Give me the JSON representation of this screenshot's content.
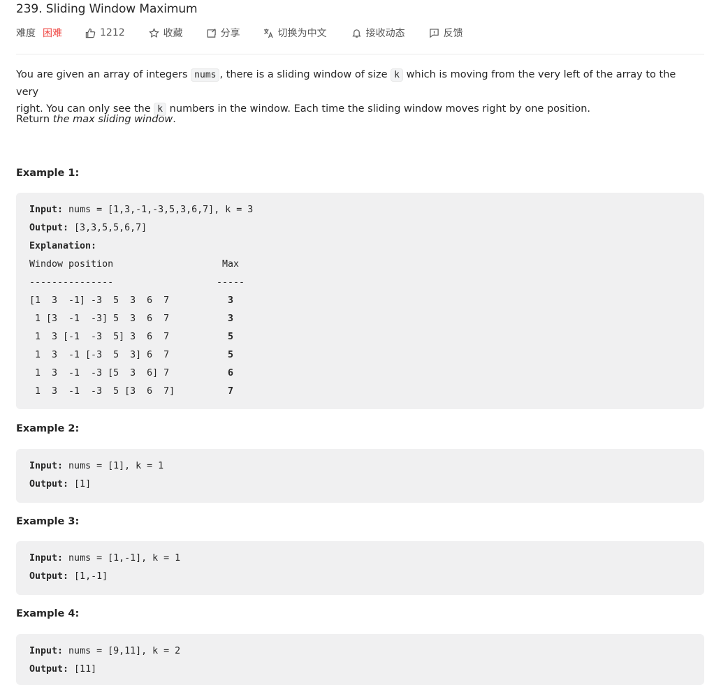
{
  "problem": {
    "title": "239. Sliding Window Maximum"
  },
  "toolbar": {
    "difficulty_label": "难度",
    "difficulty_value": "困难",
    "like_count": "1212",
    "favorite": "收藏",
    "share": "分享",
    "translate": "切换为中文",
    "subscribe": "接收动态",
    "feedback": "反馈"
  },
  "colors": {
    "difficulty_hard": "#ef4743",
    "code_bg": "#f0f0f1"
  },
  "description": {
    "p1_a": "You are given an array of integers ",
    "p1_code1": "nums",
    "p1_b": ", there is a sliding window of size ",
    "p1_code2": "k",
    "p1_c": " which is moving from the very left of the array to the very",
    "p1_line2_a": "right. You can only see the ",
    "p1_code3": "k",
    "p1_line2_b": " numbers in the window. Each time the sliding window moves right by one position.",
    "p2_a": "Return ",
    "p2_em": "the max sliding window",
    "p2_b": "."
  },
  "examples": [
    {
      "title": "Example 1:",
      "input_label": "Input:",
      "input": " nums = [1,3,-1,-3,5,3,6,7], k = 3",
      "output_label": "Output:",
      "output": " [3,3,5,5,6,7]",
      "explanation_label": "Explanation:",
      "header_left": "Window position",
      "header_right": "Max",
      "rule_left": "---------------",
      "rule_right": "-----",
      "rows": [
        {
          "window": "[1  3  -1] -3  5  3  6  7",
          "max": "3"
        },
        {
          "window": " 1 [3  -1  -3] 5  3  6  7",
          "max": "3"
        },
        {
          "window": " 1  3 [-1  -3  5] 3  6  7",
          "max": "5"
        },
        {
          "window": " 1  3  -1 [-3  5  3] 6  7",
          "max": "5"
        },
        {
          "window": " 1  3  -1  -3 [5  3  6] 7",
          "max": "6"
        },
        {
          "window": " 1  3  -1  -3  5 [3  6  7]",
          "max": "7"
        }
      ]
    },
    {
      "title": "Example 2:",
      "input_label": "Input:",
      "input": " nums = [1], k = 1",
      "output_label": "Output:",
      "output": " [1]"
    },
    {
      "title": "Example 3:",
      "input_label": "Input:",
      "input": " nums = [1,-1], k = 1",
      "output_label": "Output:",
      "output": " [1,-1]"
    },
    {
      "title": "Example 4:",
      "input_label": "Input:",
      "input": " nums = [9,11], k = 2",
      "output_label": "Output:",
      "output": " [11]"
    }
  ]
}
